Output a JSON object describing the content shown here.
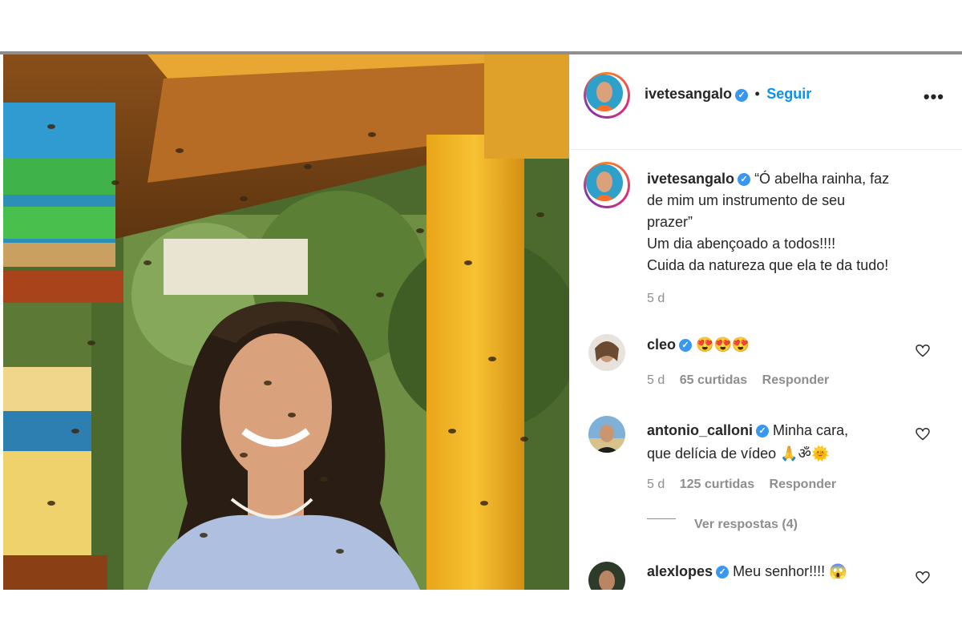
{
  "post": {
    "author": "ivetesangalo",
    "follow_label": "Seguir",
    "separator": "•",
    "more_label": "•••"
  },
  "caption": {
    "username": "ivetesangalo",
    "line1": "“Ó abelha rainha, faz",
    "line2": "de mim um instrumento de seu",
    "line3": "prazer”",
    "line4": "Um dia abençoado a todos!!!!",
    "line5": "Cuida da natureza que ela te da tudo!",
    "time": "5 d"
  },
  "comments": [
    {
      "username": "cleo",
      "text": "",
      "emoji": "😍😍😍",
      "time": "5 d",
      "likes": "65 curtidas",
      "reply": "Responder"
    },
    {
      "username": "antonio_calloni",
      "text_line1": "Minha cara,",
      "text_line2": "que delícia de vídeo",
      "emoji": "🙏ॐ🌞",
      "time": "5 d",
      "likes": "125 curtidas",
      "reply": "Responder",
      "view_replies": "Ver respostas (4)"
    },
    {
      "username": "alexlopes",
      "text": "Meu senhor!!!!",
      "emoji": "😱"
    }
  ],
  "colors": {
    "link": "#0095f6",
    "verified": "#3897f0",
    "meta": "#8e8e8e"
  }
}
